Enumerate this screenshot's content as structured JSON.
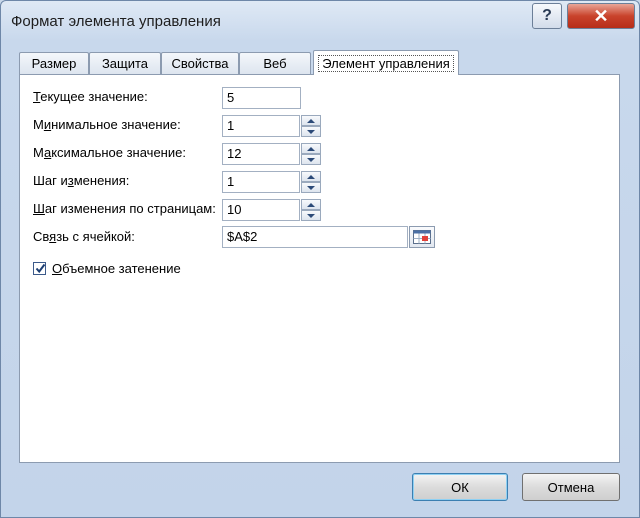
{
  "window": {
    "title": "Формат элемента управления",
    "help_label": "?",
    "close_label": "✕"
  },
  "tabs": [
    {
      "label": "Размер"
    },
    {
      "label": "Защита"
    },
    {
      "label": "Свойства"
    },
    {
      "label": "Веб"
    },
    {
      "label": "Элемент управления"
    }
  ],
  "form": {
    "current_value": {
      "label_u": "Т",
      "label_rest": "екущее значение:",
      "value": "5"
    },
    "min_value": {
      "label_pre": "М",
      "label_u": "и",
      "label_rest": "нимальное значение:",
      "value": "1"
    },
    "max_value": {
      "label_pre": "М",
      "label_u": "а",
      "label_rest": "ксимальное значение:",
      "value": "12"
    },
    "step": {
      "label_pre": "Шаг и",
      "label_u": "з",
      "label_rest": "менения:",
      "value": "1"
    },
    "page_step": {
      "label_u": "Ш",
      "label_rest": "аг изменения по страницам:",
      "value": "10"
    },
    "cell_link": {
      "label_pre": "Св",
      "label_u": "я",
      "label_rest": "зь с ячейкой:",
      "value": "$A$2"
    },
    "shading": {
      "label_u": "О",
      "label_rest": "бъемное затенение",
      "checked": true
    }
  },
  "buttons": {
    "ok": "ОК",
    "cancel": "Отмена"
  }
}
